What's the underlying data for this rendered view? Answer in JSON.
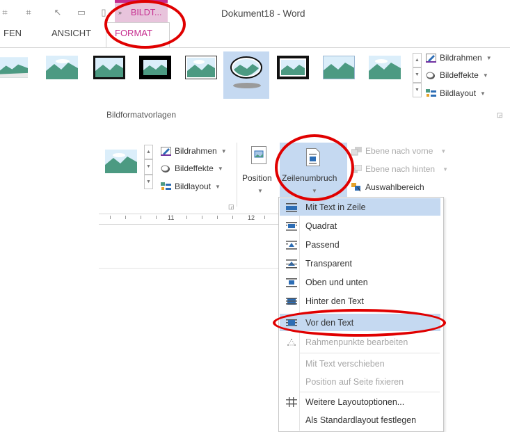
{
  "window": {
    "title": "Dokument18 - Word"
  },
  "context_tab": {
    "label": "BILDT..."
  },
  "tabs": [
    {
      "label": "FEN"
    },
    {
      "label": "ANSICHT"
    },
    {
      "label": "FORMAT"
    }
  ],
  "ribbon_top": {
    "picture_styles_group_label": "Bildformatvorlagen",
    "buttons": [
      {
        "label": "Bildrahmen"
      },
      {
        "label": "Bildeffekte"
      },
      {
        "label": "Bildlayout"
      }
    ]
  },
  "ribbon_bottom": {
    "buttons": [
      {
        "label": "Bildrahmen"
      },
      {
        "label": "Bildeffekte"
      },
      {
        "label": "Bildlayout"
      }
    ],
    "position_label": "Position",
    "wrap_label": "Zeilenumbruch",
    "arrange": [
      {
        "label": "Ebene nach vorne"
      },
      {
        "label": "Ebene nach hinten"
      },
      {
        "label": "Auswahlbereich"
      }
    ]
  },
  "ruler": {
    "labels": [
      "11",
      "12"
    ]
  },
  "dropdown": {
    "items": [
      {
        "label": "Mit Text in Zeile",
        "icon": "inline-wrap-icon",
        "enabled": true,
        "highlighted": true
      },
      {
        "label": "Quadrat",
        "icon": "square-wrap-icon",
        "enabled": true
      },
      {
        "label": "Passend",
        "icon": "tight-wrap-icon",
        "enabled": true
      },
      {
        "label": "Transparent",
        "icon": "through-wrap-icon",
        "enabled": true
      },
      {
        "label": "Oben und unten",
        "icon": "top-bottom-wrap-icon",
        "enabled": true
      },
      {
        "label": "Hinter den Text",
        "icon": "behind-text-icon",
        "enabled": true
      },
      {
        "label": "Vor den Text",
        "icon": "in-front-text-icon",
        "enabled": true,
        "highlighted": true
      },
      {
        "label": "Rahmenpunkte bearbeiten",
        "icon": "edit-wrap-points-icon",
        "enabled": false
      },
      {
        "label": "Mit Text verschieben",
        "enabled": false
      },
      {
        "label": "Position auf Seite fixieren",
        "enabled": false
      },
      {
        "label": "Weitere Layoutoptionen...",
        "icon": "more-layout-icon",
        "enabled": true
      },
      {
        "label": "Als Standardlayout festlegen",
        "enabled": true
      }
    ]
  },
  "colors": {
    "accent": "#c62d8f",
    "selection": "#c5d9f1",
    "annotation": "#e00000"
  }
}
